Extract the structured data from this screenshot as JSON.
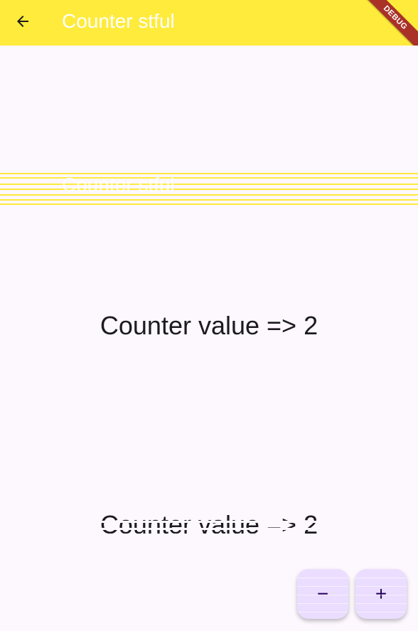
{
  "app_bar": {
    "title": "Counter stful",
    "back_icon": "arrow-back-icon",
    "background_color": "#ffeb3b",
    "debug_banner": "DEBUG"
  },
  "main": {
    "counter_text": "Counter value => 2"
  },
  "actions": {
    "decrement_label": "−",
    "increment_label": "+"
  }
}
